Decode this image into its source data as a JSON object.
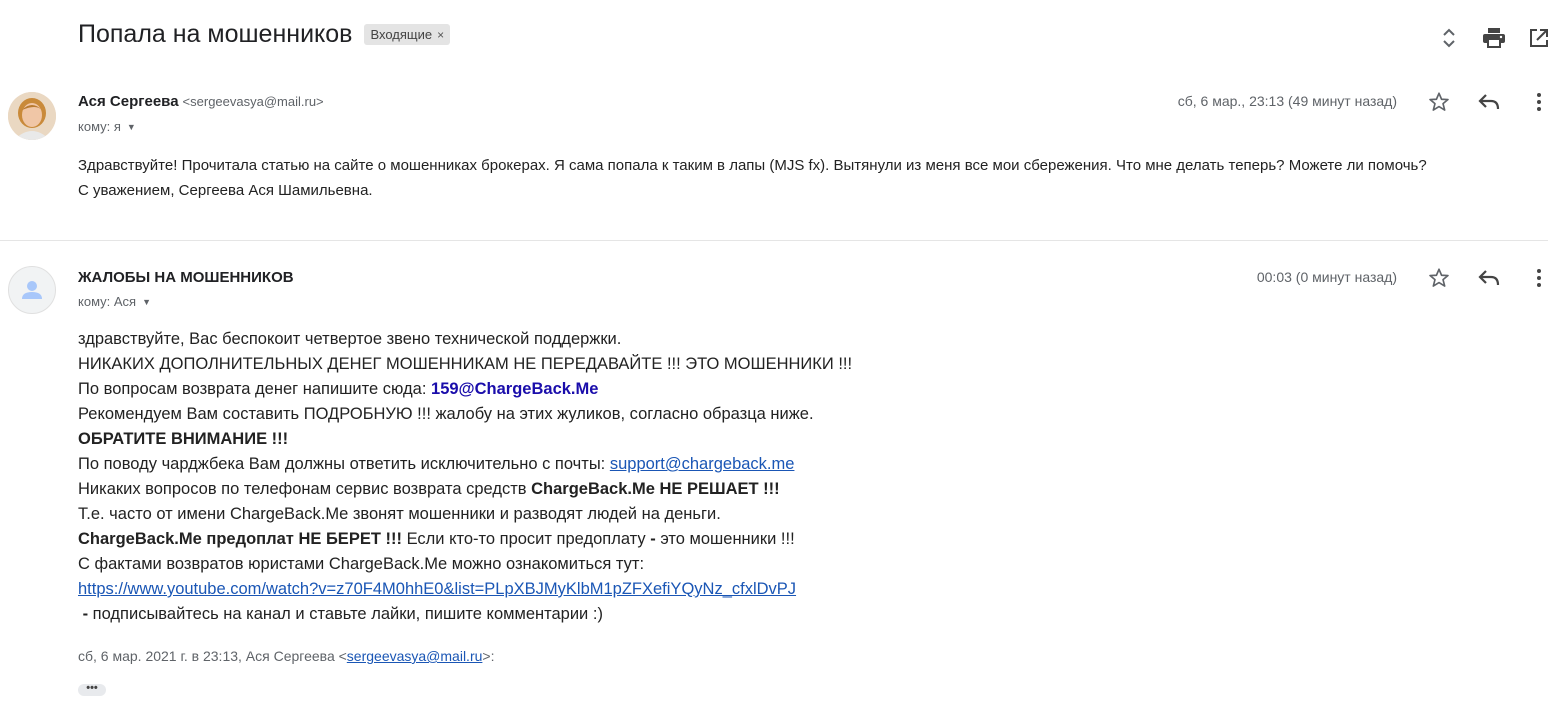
{
  "thread": {
    "subject": "Попала на мошенников",
    "label": "Входящие",
    "label_remove": "×"
  },
  "top_icons": [
    "expand-collapse-icon",
    "print-icon",
    "open-new-window-icon"
  ],
  "message1": {
    "sender_name": "Ася Сергеева",
    "sender_email": "<sergeevasya@mail.ru>",
    "recipient": "кому: я",
    "date": "сб, 6 мар., 23:13 (49 минут назад)",
    "body_lines": [
      "Здравствуйте! Прочитала статью на сайте о мошенниках брокерах. Я сама попала к таким в лапы (MJS fx). Вытянули из меня все мои сбережения. Что мне делать теперь? Можете ли помочь?",
      "С уважением, Сергеева Ася Шамильевна."
    ]
  },
  "message2": {
    "sender_name": "ЖАЛОБЫ НА МОШЕННИКОВ",
    "recipient": "кому: Ася",
    "date": "00:03 (0 минут назад)",
    "l1": "здравствуйте, Вас беспокоит четвертое звено технической поддержки.",
    "l2": "НИКАКИХ ДОПОЛНИТЕЛЬНЫХ ДЕНЕГ МОШЕННИКАМ НЕ ПЕРЕДАВАЙТЕ !!! ЭТО МОШЕННИКИ !!!",
    "l3a": "По вопросам возврата денег напишите сюда: ",
    "l3b": "159@ChargeBack.Me",
    "l4": "Рекомендуем Вам составить ПОДРОБНУЮ !!! жалобу на этих жуликов, согласно образца ниже.",
    "l5": "ОБРАТИТЕ ВНИМАНИЕ !!!",
    "l6a": "По поводу чарджбека Вам должны ответить исключительно с почты: ",
    "l6b": "support@chargeback.me",
    "l7a": "Никаких вопросов по телефонам сервис возврата средств ",
    "l7b": "ChargeBack.Me НЕ РЕШАЕТ !!!",
    "l8": "Т.е. часто от имени ChargeBack.Me звонят мошенники и разводят людей на деньги.",
    "l9a": "ChargeBack.Me предоплат НЕ БЕРЕТ !!!",
    "l9b": " Если кто-то просит предоплату ",
    "l9c": "-",
    "l9d": " это мошенники !!!",
    "l10": "С фактами возвратов юристами ChargeBack.Me можно ознакомиться тут:",
    "l11": "https://www.youtube.com/watch?v=z70F4M0hhE0&list=PLpXBJMyKlbM1pZFXefiYQyNz_cfxlDvPJ",
    "l12a": " - ",
    "l12b": "подписывайтесь на канал и ставьте лайки, пишите комментарии :)",
    "quote_prefix": "сб, 6 мар. 2021 г. в 23:13, Ася Сергеева <",
    "quote_email": "sergeevasya@mail.ru",
    "quote_suffix": ">:",
    "show_trimmed": "•••"
  }
}
